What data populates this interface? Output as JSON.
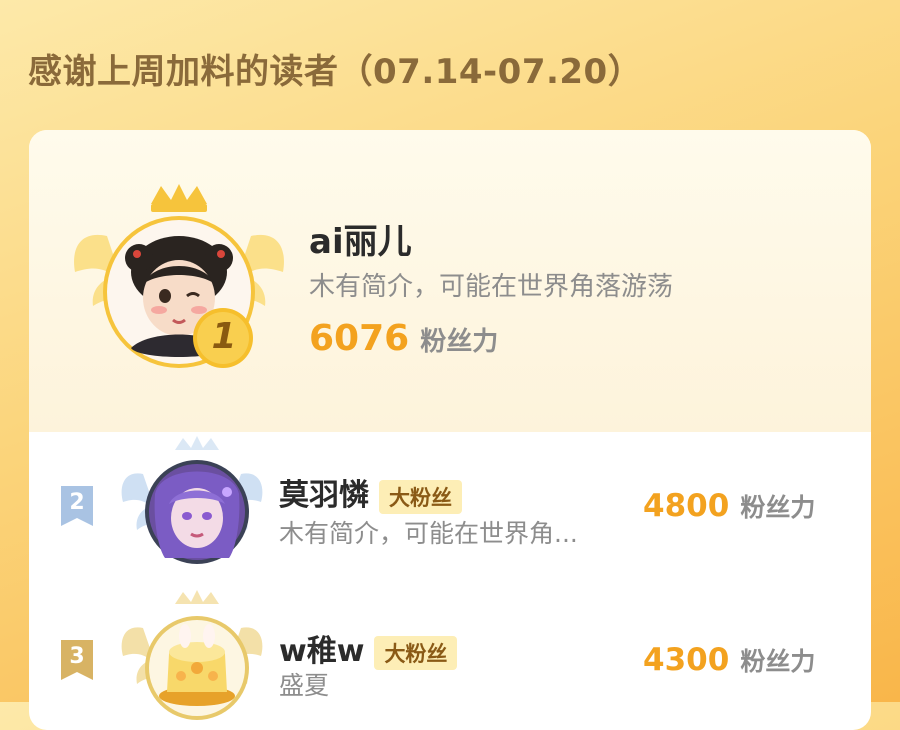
{
  "page_title": "感谢上周加料的读者（07.14-07.20）",
  "first": {
    "rank": "1",
    "name": "ai丽儿",
    "bio": "木有简介，可能在世界角落游荡",
    "score": "6076",
    "score_unit": "粉丝力"
  },
  "rows": [
    {
      "rank": "2",
      "name": "莫羽憐",
      "tag": "大粉丝",
      "bio": "木有简介，可能在世界角...",
      "score": "4800",
      "score_unit": "粉丝力"
    },
    {
      "rank": "3",
      "name": "w稚w",
      "tag": "大粉丝",
      "bio": "盛夏",
      "score": "4300",
      "score_unit": "粉丝力"
    }
  ],
  "colors": {
    "accent": "#f3a21f",
    "gold": "#f5c23a",
    "silver": "#a9c3e3",
    "bronze": "#d8b364"
  }
}
